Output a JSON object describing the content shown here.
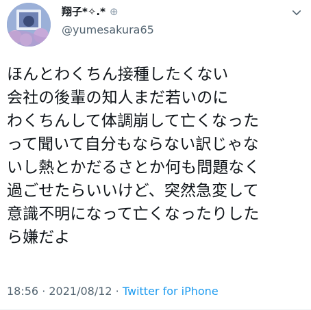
{
  "tweet": {
    "display_name": "翔子*✧.*",
    "display_name_suffix": "⊕",
    "handle": "@yumesakura65",
    "lines": [
      "ほんとわくちん接種したくない",
      "会社の後輩の知人まだ若いのに",
      "わくちんして体調崩して亡くなった",
      "って聞いて自分もならない訳じゃな",
      "いし熱とかだるさとか何も問題なく",
      "過ごせたらいいけど、突然急変して",
      "意識不明になって亡くなったりした",
      "ら嫌だよ"
    ],
    "time": "18:56",
    "date": "2021/08/12",
    "separator": " · ",
    "source": "Twitter for iPhone"
  },
  "icons": {
    "avatar": "avatar-image",
    "caret": "chevron-down-icon"
  },
  "colors": {
    "text": "#0f1419",
    "muted": "#536471",
    "link": "#1d9bf0"
  }
}
